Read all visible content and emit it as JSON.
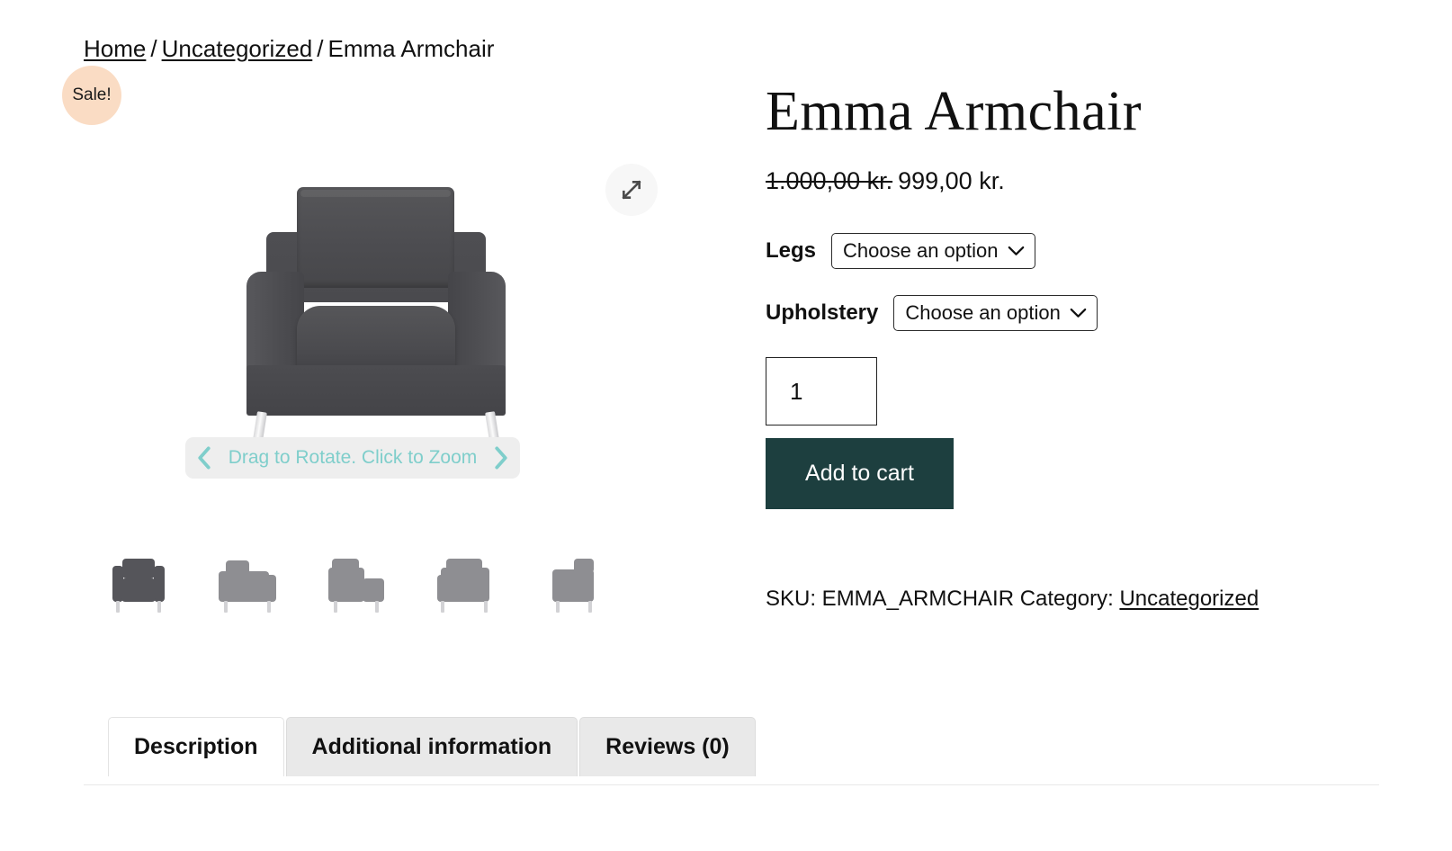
{
  "breadcrumb": {
    "home": "Home",
    "category": "Uncategorized",
    "current": "Emma Armchair",
    "separator": "/"
  },
  "badge": {
    "sale_label": "Sale!"
  },
  "gallery": {
    "expand_icon": "expand-arrows-icon",
    "rotate_hint": "Drag to Rotate. Click to Zoom",
    "prev_icon": "chevron-left-icon",
    "next_icon": "chevron-right-icon",
    "thumbnails": [
      {
        "alt": "Emma Armchair front view"
      },
      {
        "alt": "Emma Armchair three-quarter left view"
      },
      {
        "alt": "Emma Armchair left side view"
      },
      {
        "alt": "Emma Armchair rear three-quarter view"
      },
      {
        "alt": "Emma Armchair rear view"
      }
    ]
  },
  "product": {
    "title": "Emma Armchair",
    "price_old": "1.000,00 kr.",
    "price_new": "999,00 kr.",
    "sku_line": "SKU: EMMA_ARMCHAIR Category:",
    "category_link": "Uncategorized"
  },
  "variations": [
    {
      "label": "Legs",
      "selected": "Choose an option",
      "name": "legs-select",
      "arrow_icon": "chevron-down-icon"
    },
    {
      "label": "Upholstery",
      "selected": "Choose an option",
      "name": "upholstery-select",
      "arrow_icon": "chevron-down-icon"
    }
  ],
  "cart": {
    "quantity": "1",
    "add_label": "Add to cart"
  },
  "tabs": [
    {
      "label": "Description",
      "active": true
    },
    {
      "label": "Additional information",
      "active": false
    },
    {
      "label": "Reviews (0)",
      "active": false
    }
  ],
  "colors": {
    "sale_badge_bg": "#fadcc4",
    "add_to_cart_bg": "#1d3f3f",
    "rotate_hint_text": "#7fcecb",
    "rotate_bar_bg": "#eeeeee",
    "tab_inactive_bg": "#e9e9e9"
  }
}
